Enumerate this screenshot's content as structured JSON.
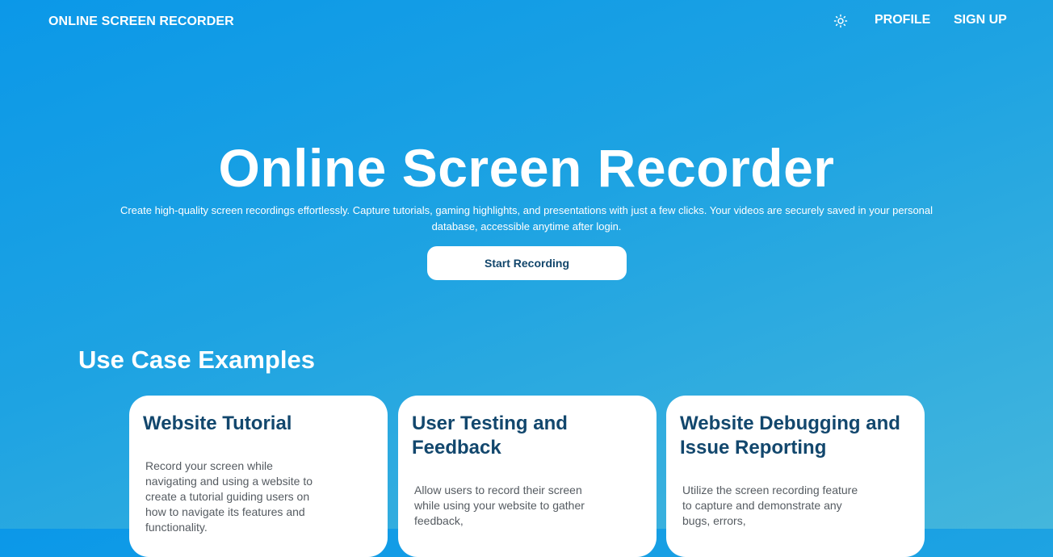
{
  "header": {
    "brand": "ONLINE SCREEN RECORDER",
    "theme_icon": "sun-icon",
    "nav": [
      {
        "label": "PROFILE"
      },
      {
        "label": "SIGN UP"
      }
    ]
  },
  "hero": {
    "title": "Online Screen Recorder",
    "subtitle": "Create high-quality screen recordings effortlessly. Capture tutorials, gaming highlights, and presentations with just a few clicks. Your videos are securely saved in your personal database, accessible anytime after login.",
    "cta_label": "Start Recording"
  },
  "use_cases": {
    "heading": "Use Case Examples",
    "cards": [
      {
        "title": "Website Tutorial",
        "text": "Record your screen while navigating and using a website to create a tutorial guiding users on how to navigate its features and functionality."
      },
      {
        "title": "User Testing and Feedback",
        "text": "Allow users to record their screen while using your website to gather feedback,"
      },
      {
        "title": "Website Debugging and Issue Reporting",
        "text": "Utilize the screen recording feature to capture and demonstrate any bugs, errors,"
      }
    ]
  },
  "colors": {
    "background_start": "#0b98e8",
    "background_end": "#44b6dc",
    "card_title": "#12476d",
    "button_text": "#12466b"
  }
}
